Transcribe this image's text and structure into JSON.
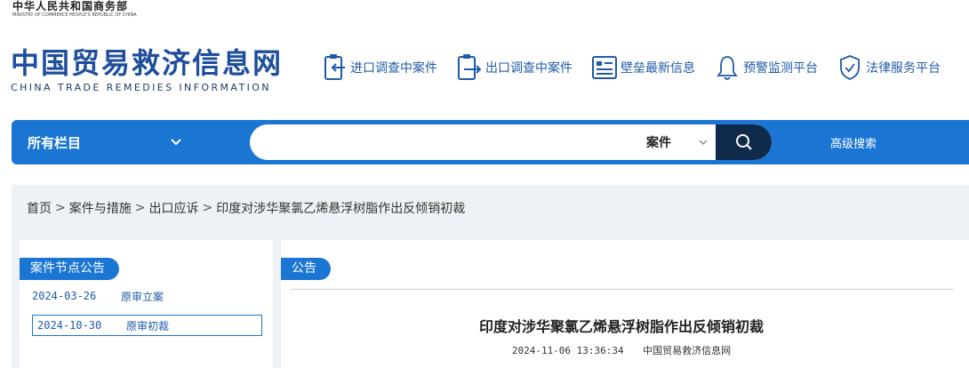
{
  "header": {
    "ministry_cn": "中华人民共和国商务部",
    "ministry_en": "MINISTRY OF COMMERCE PEOPLE'S REPUBLIC OF CHINA",
    "site_title_cn": "中国贸易救济信息网",
    "site_title_en": "CHINA TRADE REMEDIES INFORMATION",
    "nav": [
      {
        "label": "进口调查中案件",
        "icon": "clipboard-in-icon"
      },
      {
        "label": "出口调查中案件",
        "icon": "clipboard-out-icon"
      },
      {
        "label": "壁垒最新信息",
        "icon": "document-list-icon"
      },
      {
        "label": "预警监测平台",
        "icon": "bell-icon"
      },
      {
        "label": "法律服务平台",
        "icon": "shield-check-icon"
      }
    ]
  },
  "search": {
    "category_label": "所有栏目",
    "input_value": "",
    "input_placeholder": "",
    "type_label": "案件",
    "advanced_label": "高级搜索"
  },
  "breadcrumb": {
    "items": [
      "首页",
      "案件与措施",
      "出口应诉",
      "印度对涉华聚氯乙烯悬浮树脂作出反倾销初裁"
    ]
  },
  "case_nodes": {
    "title": "案件节点公告",
    "items": [
      {
        "date": "2024-03-26",
        "label": "原审立案"
      },
      {
        "date": "2024-10-30",
        "label": "原审初裁"
      }
    ]
  },
  "article": {
    "section": "公告",
    "title": "印度对涉华聚氯乙烯悬浮树脂作出反倾销初裁",
    "datetime": "2024-11-06 13:36:34",
    "source": "中国贸易救济信息网"
  },
  "colors": {
    "primary": "#1a76d2",
    "brand_text": "#1e4e9c",
    "search_button": "#0f2a4a",
    "content_bg": "#eef1f5"
  }
}
